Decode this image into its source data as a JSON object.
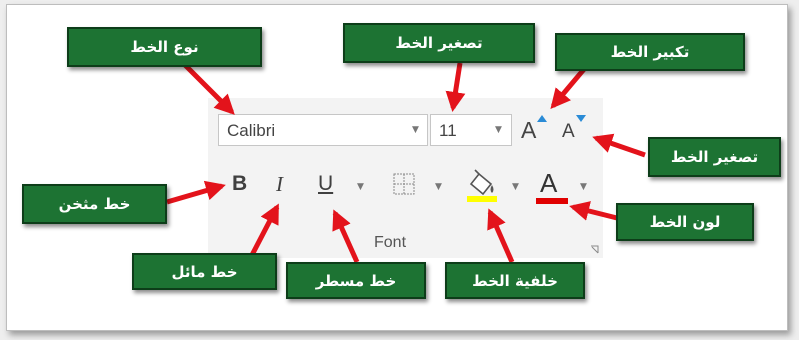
{
  "ribbon": {
    "font_name": "Calibri",
    "font_size": "11",
    "grow_font": "A",
    "shrink_font": "A",
    "bold": "B",
    "italic": "I",
    "underline": "U",
    "font_color": "A",
    "group_title": "Font",
    "highlight_color": "#ffff00",
    "font_color_bar": "#e00000"
  },
  "labels": {
    "font_type": "نوع الخط",
    "shrink_top": "تصغير الخط",
    "grow": "تكبير الخط",
    "shrink_right": "تصغير الخط",
    "bold": "خط مثخن",
    "font_color": "لون الخط",
    "italic": "خط مائل",
    "underline": "خط مسطر",
    "highlight": "خلفية الخط"
  },
  "colors": {
    "label_bg": "#1d7333",
    "arrow": "#e3131b"
  }
}
